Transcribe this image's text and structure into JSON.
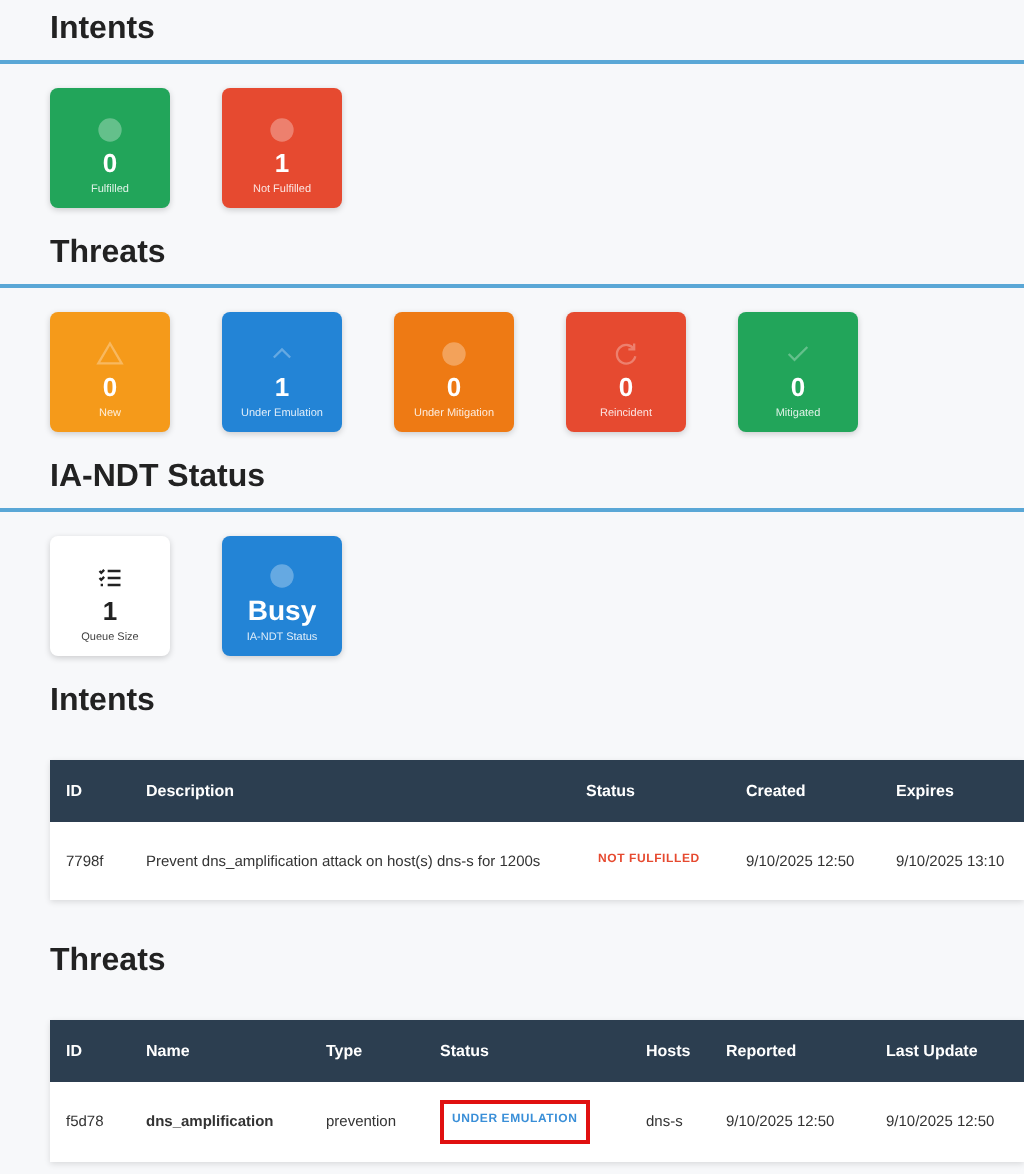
{
  "sections": [
    {
      "kind": "cards",
      "title": "Intents",
      "cards": [
        {
          "value": "0",
          "label": "Fulfilled",
          "color": "#22a55a"
        },
        {
          "value": "1",
          "label": "Not Fulfilled",
          "color": "#e64a30"
        }
      ]
    },
    {
      "kind": "cards",
      "title": "Threats",
      "cards": [
        {
          "value": "0",
          "label": "New",
          "color": "#f59a1a"
        },
        {
          "value": "1",
          "label": "Under Emulation",
          "color": "#2384d6"
        },
        {
          "value": "0",
          "label": "Under Mitigation",
          "color": "#ee7a14"
        },
        {
          "value": "0",
          "label": "Reincident",
          "color": "#e64a30"
        },
        {
          "value": "0",
          "label": "Mitigated",
          "color": "#22a55a"
        }
      ]
    },
    {
      "kind": "status",
      "title": "IA-NDT Status",
      "cards": [
        {
          "kind": "plain",
          "value": "1",
          "label": "Queue Size"
        },
        {
          "kind": "filled",
          "value": "Busy",
          "label": "IA-NDT Status",
          "color": "#2384d6"
        }
      ]
    },
    {
      "kind": "table",
      "title": "Intents",
      "columns": [
        "ID",
        "Description",
        "Status",
        "Created",
        "Expires"
      ],
      "rows": [
        {
          "cells": [
            "7798f",
            "Prevent dns_amplification attack on host(s) dns-s for 1200s",
            "NOT FULFILLED",
            "9/10/2025 12:50",
            "9/10/2025 13:10"
          ],
          "color": "#e64a30",
          "highlighted": false
        }
      ]
    },
    {
      "kind": "table",
      "title": "Threats",
      "columns": [
        "ID",
        "Name",
        "Type",
        "Status",
        "Hosts",
        "Reported",
        "Last Update"
      ],
      "rows": [
        {
          "cells": [
            "f5d78",
            "dns_amplification",
            "prevention",
            "UNDER EMULATION",
            "dns-s",
            "9/10/2025 12:50",
            "9/10/2025 12:50"
          ],
          "color": "#3a8fd8",
          "highlighted": true
        }
      ]
    }
  ]
}
